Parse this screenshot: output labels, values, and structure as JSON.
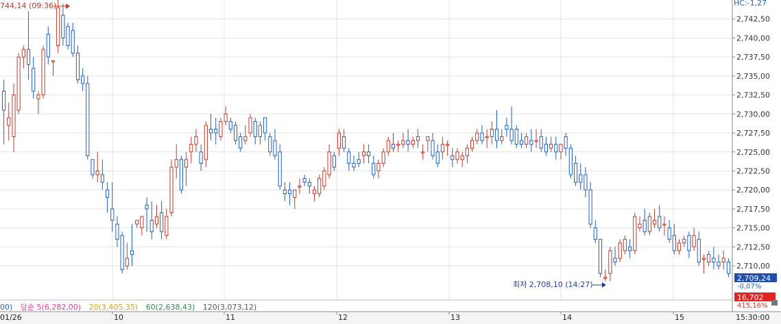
{
  "chart_data": {
    "type": "candlestick",
    "x_ticks": [
      "01/26",
      "10",
      "11",
      "12",
      "13",
      "14",
      "15"
    ],
    "y_ticks": [
      "2,742,50",
      "2,740,00",
      "2,737,50",
      "2,735,00",
      "2,732,50",
      "2,730,00",
      "2,727,50",
      "2,725,00",
      "2,722,50",
      "2,720,00",
      "2,717,50",
      "2,715,00",
      "2,712,50",
      "2,710,00"
    ],
    "ylim": [
      2705.5,
      2745.0
    ],
    "grid": true,
    "up_color": "#c0392b",
    "down_color": "#1f5fbf",
    "time_label": "15:30:00",
    "annotations": {
      "high": "744,14 (09:36)",
      "low": "최저 2,708,10 (14:27)",
      "top_right": "HC:-1,27",
      "current_price": "2,709,24",
      "change_pct": "-0,07%",
      "value_box": "16,702",
      "pct_box": "415,16%"
    },
    "ma_legend": [
      {
        "label": "00)",
        "color": "#1f5fbf"
      },
      {
        "label": "당순 5(6,282,00)",
        "color": "#e83e8c"
      },
      {
        "label": "20(3,405,35)",
        "color": "#d4a017"
      },
      {
        "label": "60(2,638,43)",
        "color": "#2e8b57"
      },
      {
        "label": "120(3,073,12)",
        "color": "#555555"
      }
    ],
    "candles": [
      [
        2733.0,
        2734.5,
        2730.5,
        2726.0
      ],
      [
        2728.5,
        2731.5,
        2729.5,
        2726.5
      ],
      [
        2727.0,
        2734.0,
        2732.5,
        2725.0
      ],
      [
        2730.5,
        2738.0,
        2737.5,
        2730.0
      ],
      [
        2737.5,
        2739.0,
        2738.5,
        2736.0
      ],
      [
        2738.5,
        2743.5,
        2736.5,
        2734.5
      ],
      [
        2736.0,
        2737.5,
        2733.0,
        2732.0
      ],
      [
        2732.0,
        2733.0,
        2732.5,
        2730.0
      ],
      [
        2732.5,
        2739.0,
        2738.5,
        2732.0
      ],
      [
        2740.5,
        2741.5,
        2737.5,
        2736.5
      ],
      [
        2737.0,
        2737.0,
        2737.0,
        2735.0
      ],
      [
        2739.0,
        2745.0,
        2744.0,
        2738.0
      ],
      [
        2743.0,
        2744.5,
        2740.0,
        2739.0
      ],
      [
        2741.5,
        2742.0,
        2739.0,
        2738.5
      ],
      [
        2741.0,
        2742.0,
        2738.0,
        2737.5
      ],
      [
        2738.0,
        2739.0,
        2734.5,
        2734.0
      ],
      [
        2735.0,
        2736.0,
        2734.0,
        2733.0
      ],
      [
        2734.0,
        2735.0,
        2724.5,
        2724.0
      ],
      [
        2724.0,
        2724.0,
        2722.0,
        2721.5
      ],
      [
        2722.0,
        2725.0,
        2722.5,
        2721.0
      ],
      [
        2722.0,
        2724.0,
        2721.0,
        2720.0
      ],
      [
        2720.0,
        2721.0,
        2719.0,
        2717.0
      ],
      [
        2717.5,
        2721.0,
        2716.0,
        2714.5
      ],
      [
        2715.5,
        2716.5,
        2713.5,
        2712.5
      ],
      [
        2714.0,
        2714.5,
        2709.5,
        2709.0
      ],
      [
        2710.0,
        2713.0,
        2711.0,
        2709.5
      ],
      [
        2712.0,
        2715.5,
        2711.5,
        2710.0
      ],
      [
        2715.5,
        2716.0,
        2716.0,
        2715.0
      ],
      [
        2715.0,
        2715.5,
        2716.5,
        2714.0
      ],
      [
        2718.0,
        2719.0,
        2717.5,
        2714.5
      ],
      [
        2716.0,
        2718.5,
        2714.5,
        2713.5
      ],
      [
        2715.5,
        2718.0,
        2716.5,
        2715.0
      ],
      [
        2717.0,
        2718.5,
        2714.5,
        2713.5
      ],
      [
        2714.0,
        2717.5,
        2716.5,
        2713.5
      ],
      [
        2717.0,
        2724.0,
        2723.0,
        2716.5
      ],
      [
        2723.0,
        2726.0,
        2724.0,
        2721.5
      ],
      [
        2724.0,
        2724.5,
        2720.0,
        2719.5
      ],
      [
        2723.0,
        2725.0,
        2724.0,
        2720.5
      ],
      [
        2725.0,
        2727.0,
        2726.0,
        2723.5
      ],
      [
        2726.0,
        2728.0,
        2727.0,
        2725.0
      ],
      [
        2725.0,
        2726.0,
        2723.5,
        2722.5
      ],
      [
        2724.0,
        2729.0,
        2728.5,
        2723.0
      ],
      [
        2728.0,
        2730.0,
        2727.5,
        2726.5
      ],
      [
        2728.0,
        2729.5,
        2727.5,
        2726.0
      ],
      [
        2727.0,
        2729.5,
        2729.0,
        2726.5
      ],
      [
        2729.0,
        2731.0,
        2730.0,
        2728.5
      ],
      [
        2729.0,
        2729.5,
        2728.0,
        2727.5
      ],
      [
        2728.5,
        2729.0,
        2726.5,
        2726.0
      ],
      [
        2727.0,
        2727.5,
        2725.5,
        2725.0
      ],
      [
        2726.5,
        2728.5,
        2727.0,
        2726.0
      ],
      [
        2727.5,
        2730.0,
        2729.5,
        2727.0
      ],
      [
        2729.0,
        2729.5,
        2727.0,
        2726.0
      ],
      [
        2727.0,
        2729.0,
        2728.5,
        2726.0
      ],
      [
        2729.5,
        2729.5,
        2727.5,
        2726.5
      ],
      [
        2727.0,
        2727.5,
        2725.0,
        2724.5
      ],
      [
        2726.5,
        2728.0,
        2724.5,
        2724.0
      ],
      [
        2725.0,
        2726.0,
        2720.5,
        2720.0
      ],
      [
        2720.0,
        2721.0,
        2719.5,
        2718.5
      ],
      [
        2720.0,
        2721.0,
        2719.5,
        2718.0
      ],
      [
        2719.0,
        2720.0,
        2720.0,
        2717.5
      ],
      [
        2720.5,
        2721.5,
        2720.5,
        2719.5
      ],
      [
        2721.5,
        2722.0,
        2721.0,
        2720.5
      ],
      [
        2721.0,
        2721.5,
        2720.5,
        2719.5
      ],
      [
        2719.5,
        2720.5,
        2720.0,
        2718.5
      ],
      [
        2719.5,
        2722.0,
        2721.5,
        2719.0
      ],
      [
        2720.5,
        2723.0,
        2722.5,
        2720.0
      ],
      [
        2722.0,
        2726.0,
        2725.0,
        2721.5
      ],
      [
        2724.5,
        2725.0,
        2723.0,
        2722.5
      ],
      [
        2725.5,
        2728.0,
        2727.5,
        2724.5
      ],
      [
        2727.0,
        2728.0,
        2725.5,
        2725.0
      ],
      [
        2725.0,
        2725.5,
        2723.5,
        2722.5
      ],
      [
        2723.5,
        2724.5,
        2723.0,
        2722.5
      ],
      [
        2724.0,
        2725.0,
        2723.5,
        2723.0
      ],
      [
        2724.5,
        2726.0,
        2725.0,
        2723.5
      ],
      [
        2725.0,
        2726.0,
        2724.5,
        2723.5
      ],
      [
        2723.5,
        2724.5,
        2722.0,
        2721.5
      ],
      [
        2722.5,
        2724.0,
        2723.5,
        2721.5
      ],
      [
        2723.5,
        2725.5,
        2725.0,
        2723.0
      ],
      [
        2725.0,
        2727.0,
        2726.5,
        2724.5
      ],
      [
        2726.0,
        2727.5,
        2725.5,
        2725.0
      ],
      [
        2726.0,
        2726.5,
        2726.0,
        2725.0
      ],
      [
        2726.0,
        2727.5,
        2726.5,
        2725.5
      ],
      [
        2726.5,
        2728.0,
        2726.0,
        2725.0
      ],
      [
        2726.0,
        2727.0,
        2726.5,
        2725.5
      ],
      [
        2726.5,
        2728.0,
        2727.0,
        2725.5
      ],
      [
        2725.0,
        2726.0,
        2725.0,
        2724.0
      ],
      [
        2726.5,
        2727.0,
        2727.0,
        2725.0
      ],
      [
        2726.5,
        2727.5,
        2724.5,
        2724.0
      ],
      [
        2725.0,
        2726.0,
        2723.5,
        2723.0
      ],
      [
        2725.0,
        2727.0,
        2726.0,
        2724.0
      ],
      [
        2726.0,
        2726.5,
        2726.0,
        2724.5
      ],
      [
        2724.5,
        2725.5,
        2724.0,
        2723.0
      ],
      [
        2724.0,
        2725.5,
        2725.0,
        2723.5
      ],
      [
        2724.0,
        2725.0,
        2724.5,
        2723.0
      ],
      [
        2724.5,
        2726.0,
        2725.5,
        2723.5
      ],
      [
        2725.5,
        2727.0,
        2726.5,
        2725.0
      ],
      [
        2726.5,
        2728.0,
        2727.5,
        2726.0
      ],
      [
        2727.5,
        2728.5,
        2726.5,
        2726.0
      ],
      [
        2727.0,
        2728.0,
        2727.0,
        2725.5
      ],
      [
        2727.0,
        2729.0,
        2728.0,
        2726.0
      ],
      [
        2728.0,
        2730.5,
        2726.5,
        2725.5
      ],
      [
        2726.5,
        2728.0,
        2727.0,
        2726.0
      ],
      [
        2728.5,
        2729.5,
        2728.0,
        2727.0
      ],
      [
        2728.0,
        2731.0,
        2726.5,
        2726.0
      ],
      [
        2728.0,
        2728.5,
        2726.0,
        2725.5
      ],
      [
        2726.5,
        2727.5,
        2726.0,
        2725.5
      ],
      [
        2726.0,
        2727.5,
        2727.0,
        2725.5
      ],
      [
        2726.5,
        2728.0,
        2726.0,
        2725.0
      ],
      [
        2726.5,
        2728.0,
        2726.5,
        2725.5
      ],
      [
        2727.0,
        2728.0,
        2725.5,
        2725.0
      ],
      [
        2726.0,
        2727.0,
        2725.0,
        2724.5
      ],
      [
        2725.5,
        2727.0,
        2726.0,
        2725.0
      ],
      [
        2726.0,
        2727.0,
        2725.0,
        2724.0
      ],
      [
        2725.0,
        2726.0,
        2726.0,
        2724.0
      ],
      [
        2727.0,
        2727.5,
        2725.5,
        2724.5
      ],
      [
        2725.5,
        2726.0,
        2722.0,
        2721.5
      ],
      [
        2723.5,
        2724.5,
        2721.0,
        2720.5
      ],
      [
        2722.0,
        2723.5,
        2721.0,
        2720.0
      ],
      [
        2722.0,
        2723.0,
        2720.0,
        2719.0
      ],
      [
        2720.0,
        2721.0,
        2715.5,
        2715.0
      ],
      [
        2715.0,
        2716.0,
        2713.5,
        2713.0
      ],
      [
        2713.5,
        2713.5,
        2709.0,
        2708.5
      ],
      [
        2708.5,
        2709.5,
        2708.5,
        2708.0
      ],
      [
        2709.0,
        2712.5,
        2712.0,
        2708.0
      ],
      [
        2711.0,
        2712.5,
        2710.5,
        2710.0
      ],
      [
        2711.0,
        2713.5,
        2713.0,
        2710.5
      ],
      [
        2712.0,
        2714.0,
        2713.5,
        2711.5
      ],
      [
        2712.5,
        2713.5,
        2712.0,
        2711.0
      ],
      [
        2712.0,
        2717.0,
        2716.5,
        2711.5
      ],
      [
        2715.0,
        2716.5,
        2715.5,
        2714.5
      ],
      [
        2716.0,
        2717.5,
        2714.5,
        2714.0
      ],
      [
        2714.5,
        2717.0,
        2716.5,
        2714.0
      ],
      [
        2715.5,
        2717.5,
        2716.0,
        2715.0
      ],
      [
        2716.5,
        2718.0,
        2715.0,
        2714.5
      ],
      [
        2715.5,
        2716.5,
        2715.5,
        2714.0
      ],
      [
        2715.0,
        2716.0,
        2713.5,
        2713.0
      ],
      [
        2714.0,
        2715.5,
        2712.0,
        2711.5
      ],
      [
        2712.0,
        2713.5,
        2713.0,
        2711.5
      ],
      [
        2713.0,
        2714.0,
        2713.5,
        2712.5
      ],
      [
        2714.0,
        2714.5,
        2712.0,
        2711.0
      ],
      [
        2712.5,
        2715.0,
        2714.0,
        2712.0
      ],
      [
        2713.5,
        2714.5,
        2710.5,
        2710.0
      ],
      [
        2711.0,
        2711.5,
        2711.0,
        2709.0
      ],
      [
        2710.5,
        2712.0,
        2711.5,
        2710.0
      ],
      [
        2711.0,
        2712.5,
        2710.5,
        2709.5
      ],
      [
        2710.5,
        2711.5,
        2710.0,
        2709.5
      ],
      [
        2710.5,
        2712.0,
        2711.0,
        2709.5
      ],
      [
        2710.5,
        2711.0,
        2709.0,
        2708.5
      ]
    ]
  }
}
